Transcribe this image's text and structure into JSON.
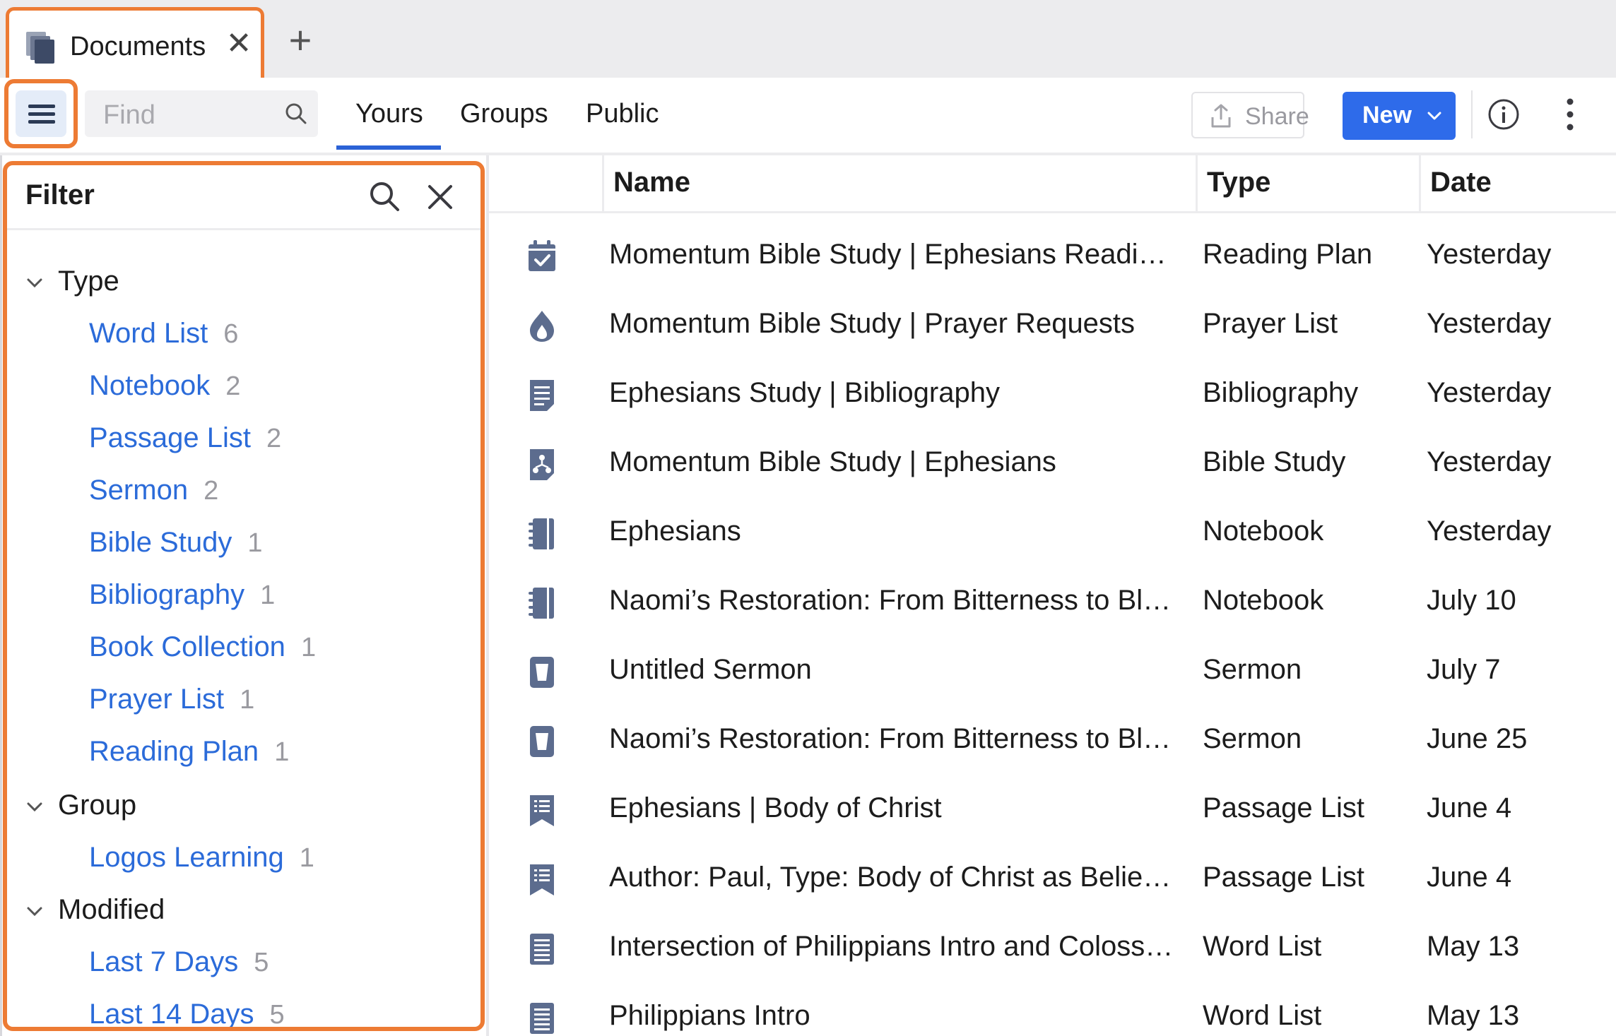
{
  "tab": {
    "title": "Documents",
    "close_symbol": "✕",
    "add_symbol": "+"
  },
  "toolbar": {
    "find_placeholder": "Find",
    "nav_tabs": [
      {
        "label": "Yours",
        "selected": true
      },
      {
        "label": "Groups",
        "selected": false
      },
      {
        "label": "Public",
        "selected": false
      }
    ],
    "share_label": "Share",
    "new_label": "New"
  },
  "filter": {
    "title": "Filter",
    "groups": [
      {
        "label": "Type",
        "expanded": true,
        "items": [
          {
            "label": "Word List",
            "count": "6"
          },
          {
            "label": "Notebook",
            "count": "2"
          },
          {
            "label": "Passage List",
            "count": "2"
          },
          {
            "label": "Sermon",
            "count": "2"
          },
          {
            "label": "Bible Study",
            "count": "1"
          },
          {
            "label": "Bibliography",
            "count": "1"
          },
          {
            "label": "Book Collection",
            "count": "1"
          },
          {
            "label": "Prayer List",
            "count": "1"
          },
          {
            "label": "Reading Plan",
            "count": "1"
          }
        ]
      },
      {
        "label": "Group",
        "expanded": true,
        "items": [
          {
            "label": "Logos Learning",
            "count": "1"
          }
        ]
      },
      {
        "label": "Modified",
        "expanded": true,
        "items": [
          {
            "label": "Last 7 Days",
            "count": "5"
          },
          {
            "label": "Last 14 Days",
            "count": "5"
          }
        ]
      }
    ]
  },
  "table": {
    "columns": {
      "name": "Name",
      "type": "Type",
      "date": "Date"
    },
    "rows": [
      {
        "icon": "reading-plan-icon",
        "name": "Momentum Bible Study | Ephesians Readin…",
        "type": "Reading Plan",
        "date": "Yesterday"
      },
      {
        "icon": "prayer-list-icon",
        "name": "Momentum Bible Study | Prayer Requests",
        "type": "Prayer List",
        "date": "Yesterday"
      },
      {
        "icon": "bibliography-icon",
        "name": "Ephesians Study | Bibliography",
        "type": "Bibliography",
        "date": "Yesterday"
      },
      {
        "icon": "bible-study-icon",
        "name": "Momentum Bible Study | Ephesians",
        "type": "Bible Study",
        "date": "Yesterday"
      },
      {
        "icon": "notebook-icon",
        "name": "Ephesians",
        "type": "Notebook",
        "date": "Yesterday"
      },
      {
        "icon": "notebook-icon",
        "name": "Naomi’s Restoration: From Bitterness to Ble…",
        "type": "Notebook",
        "date": "July 10"
      },
      {
        "icon": "sermon-icon",
        "name": "Untitled Sermon",
        "type": "Sermon",
        "date": "July 7"
      },
      {
        "icon": "sermon-icon",
        "name": "Naomi’s Restoration: From Bitterness to Ble…",
        "type": "Sermon",
        "date": "June 25"
      },
      {
        "icon": "passage-list-icon",
        "name": "Ephesians | Body of Christ",
        "type": "Passage List",
        "date": "June 4"
      },
      {
        "icon": "passage-list-icon",
        "name": "Author: Paul, Type: Body of Christ as Believ…",
        "type": "Passage List",
        "date": "June 4"
      },
      {
        "icon": "word-list-icon",
        "name": "Intersection of Philippians Intro and Coloss…",
        "type": "Word List",
        "date": "May 13"
      },
      {
        "icon": "word-list-icon",
        "name": "Philippians Intro",
        "type": "Word List",
        "date": "May 13"
      }
    ]
  },
  "colors": {
    "highlight_outline": "#ed7b34",
    "accent_blue": "#2e6bea",
    "link_blue": "#2b6bd9",
    "icon_slate": "#5c6c8e"
  }
}
